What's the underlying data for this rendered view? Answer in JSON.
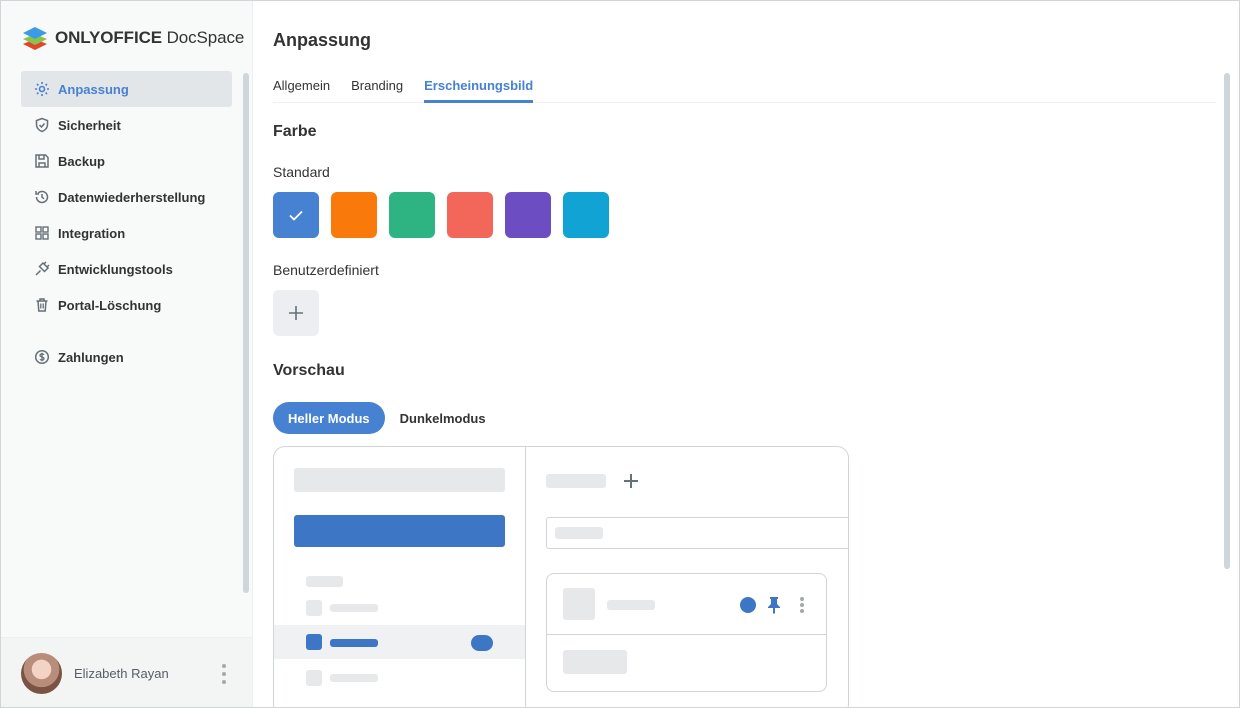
{
  "app": {
    "logo_bold": "ONLYOFFICE",
    "logo_light": " DocSpace"
  },
  "sidebar": {
    "items": [
      {
        "label": "Anpassung",
        "icon": "gear-icon",
        "active": true
      },
      {
        "label": "Sicherheit",
        "icon": "shield-icon",
        "active": false
      },
      {
        "label": "Backup",
        "icon": "floppy-disk-icon",
        "active": false
      },
      {
        "label": "Datenwiederherstellung",
        "icon": "history-icon",
        "active": false
      },
      {
        "label": "Integration",
        "icon": "grid-icon",
        "active": false
      },
      {
        "label": "Entwicklungstools",
        "icon": "plug-icon",
        "active": false
      },
      {
        "label": "Portal-Löschung",
        "icon": "trash-icon",
        "active": false
      }
    ],
    "extra_items": [
      {
        "label": "Zahlungen",
        "icon": "dollar-circle-icon",
        "active": false
      }
    ],
    "profile": {
      "name": "Elizabeth Rayan"
    }
  },
  "main": {
    "title": "Anpassung",
    "tabs": [
      {
        "label": "Allgemein",
        "active": false
      },
      {
        "label": "Branding",
        "active": false
      },
      {
        "label": "Erscheinungsbild",
        "active": true
      }
    ],
    "color_section": {
      "heading": "Farbe",
      "standard_label": "Standard",
      "standard_colors": [
        "#4781d1",
        "#f97a0b",
        "#2db482",
        "#f2675a",
        "#6d4ec2",
        "#11a3d4"
      ],
      "selected_index": 0,
      "custom_label": "Benutzerdefiniert"
    },
    "preview_section": {
      "heading": "Vorschau",
      "modes": [
        {
          "label": "Heller Modus",
          "active": true
        },
        {
          "label": "Dunkelmodus",
          "active": false
        }
      ]
    }
  },
  "colors": {
    "accent": "#4781d1",
    "text": "#333333",
    "sidebar_bg": "#f8f9f9",
    "border": "#d0d5da"
  }
}
